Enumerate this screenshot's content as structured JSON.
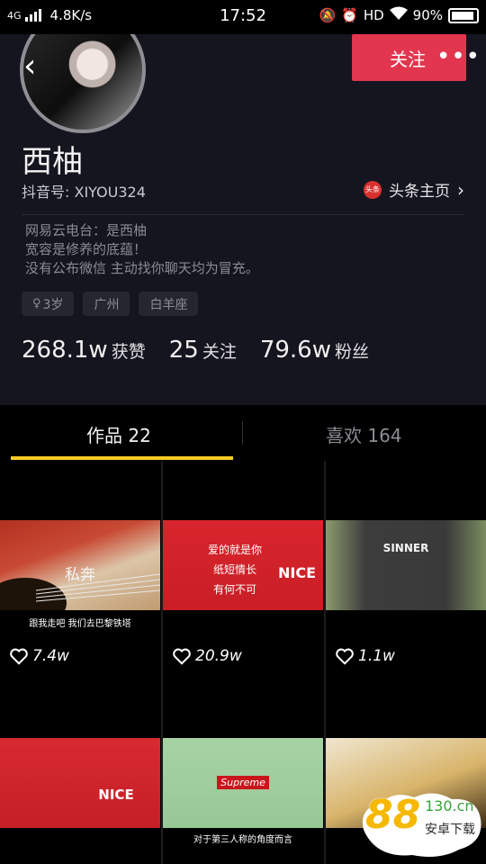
{
  "status_bar": {
    "network": "4G",
    "speed": "4.8K/s",
    "time": "17:52",
    "hd": "HD",
    "battery": "90%"
  },
  "profile": {
    "follow_label": "关注",
    "more_label": "•••",
    "name": "西柚",
    "douyin_id": "抖音号: XIYOU324",
    "toutiao_logo": "头条",
    "toutiao_link": "头条主页",
    "bio": [
      "网易云电台：是西柚",
      "宽容是修养的底蕴！",
      "没有公布微信 主动找你聊天均为冒充。"
    ],
    "tags": [
      "3岁",
      "广州",
      "白羊座"
    ],
    "stats": [
      {
        "value": "268.1w",
        "label": "获赞"
      },
      {
        "value": "25",
        "label": "关注"
      },
      {
        "value": "79.6w",
        "label": "粉丝"
      }
    ]
  },
  "tabs": {
    "works": "作品 22",
    "likes": "喜欢 164"
  },
  "videos": [
    {
      "likes": "7.4w",
      "overlay": "私奔",
      "caption": "跟我走吧 我们去巴黎铁塔"
    },
    {
      "likes": "20.9w",
      "overlay": "爱的就是你 纸短情长 有何不可",
      "shirt_text": "NICE",
      "caption": ""
    },
    {
      "likes": "1.1w",
      "shirt_text": "SINNER",
      "caption": ""
    },
    {
      "likes": "",
      "shirt_text": "NICE",
      "caption": ""
    },
    {
      "likes": "",
      "shirt_text": "Supreme",
      "caption": "对于第三人称的角度而言"
    },
    {
      "likes": "",
      "caption": ""
    }
  ],
  "watermark": {
    "number": "88",
    "suffix": "130.cn",
    "text": "安卓下载"
  },
  "colors": {
    "accent": "#facc25",
    "follow": "#e2364f",
    "header_bg": "#15151f"
  }
}
